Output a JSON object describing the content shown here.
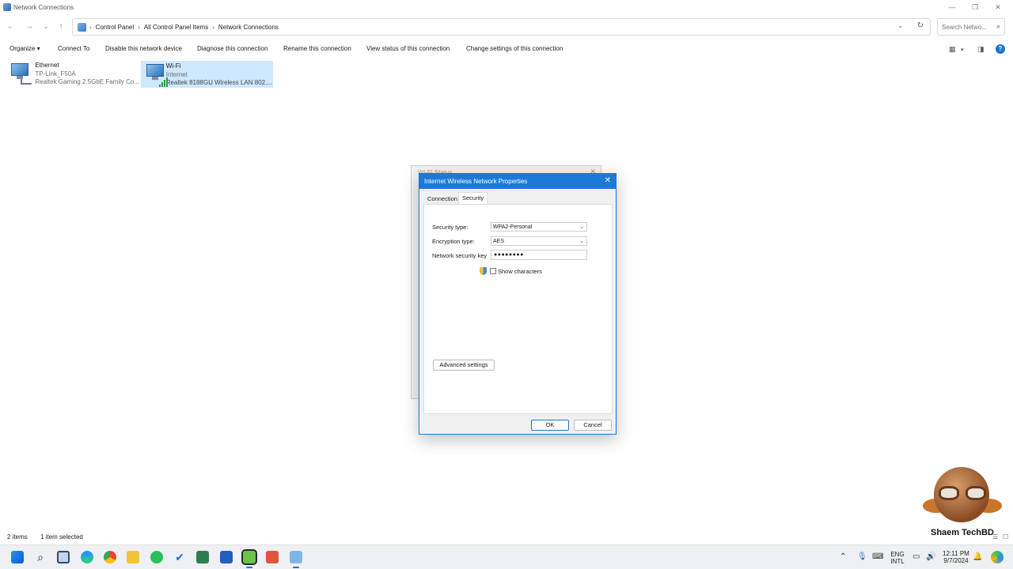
{
  "window": {
    "title": "Network Connections",
    "minimize": "—",
    "maximize": "❐",
    "close": "✕"
  },
  "address": {
    "crumbs": [
      "Control Panel",
      "All Control Panel Items",
      "Network Connections"
    ],
    "search_placeholder": "Search Netwo..."
  },
  "commands": {
    "organize": "Organize ▾",
    "connect_to": "Connect To",
    "disable": "Disable this network device",
    "diagnose": "Diagnose this connection",
    "rename": "Rename this connection",
    "view_status": "View status of this connection",
    "change_settings": "Change settings of this connection"
  },
  "items": [
    {
      "name": "Ethernet",
      "status": "TP-Link_F50A",
      "device": "Realtek Gaming 2.5GbE Family Co..."
    },
    {
      "name": "Wi-Fi",
      "status": "Internet",
      "device": "Realtek 8188GU Wireless LAN 802...."
    }
  ],
  "bg_dialog": {
    "title": "Wi-Fi Status"
  },
  "dialog": {
    "title": "Internet Wireless Network Properties",
    "tabs": [
      "Connection",
      "Security"
    ],
    "security_type_label": "Security type:",
    "security_type_value": "WPA2-Personal",
    "encryption_type_label": "Encryption type:",
    "encryption_type_value": "AES",
    "key_label": "Network security key",
    "key_value": "●●●●●●●●",
    "show_characters": "Show characters",
    "advanced": "Advanced settings",
    "ok": "OK",
    "cancel": "Cancel"
  },
  "status": {
    "count": "2 items",
    "selected": "1 item selected"
  },
  "watermark": {
    "brand": "Shaem TechBD"
  },
  "tray": {
    "lang1": "ENG",
    "lang2": "INTL",
    "time": "12:11 PM",
    "date": "9/7/2024"
  }
}
